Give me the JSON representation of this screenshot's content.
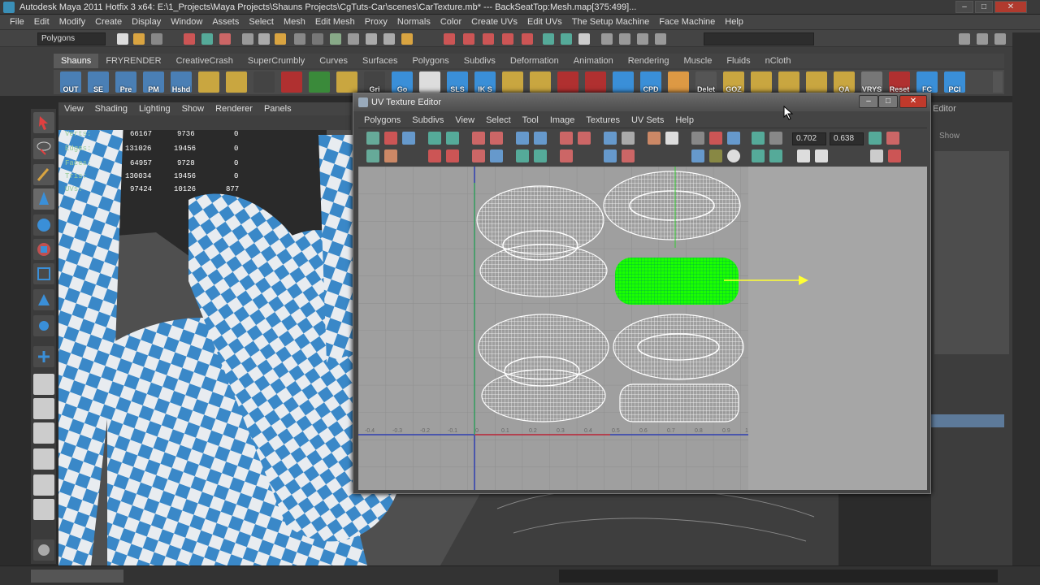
{
  "window": {
    "title": "Autodesk Maya 2011 Hotfix 3 x64: E:\\1_Projects\\Maya Projects\\Shauns Projects\\CgTuts-Car\\scenes\\CarTexture.mb*  ---  BackSeatTop:Mesh.map[375:499]..."
  },
  "menubar": [
    "File",
    "Edit",
    "Modify",
    "Create",
    "Display",
    "Window",
    "Assets",
    "Select",
    "Mesh",
    "Edit Mesh",
    "Proxy",
    "Normals",
    "Color",
    "Create UVs",
    "Edit UVs",
    "The Setup Machine",
    "Face Machine",
    "Help"
  ],
  "statusline": {
    "mode": "Polygons"
  },
  "shelf": {
    "tabs": [
      "Shauns",
      "FRYRENDER",
      "CreativeCrash",
      "SuperCrumbly",
      "Curves",
      "Surfaces",
      "Polygons",
      "Subdivs",
      "Deformation",
      "Animation",
      "Rendering",
      "Muscle",
      "Fluids",
      "nCloth"
    ],
    "active_tab": "Shauns",
    "buttons": [
      "OUT",
      "SE",
      "Pre",
      "PM",
      "Hshd",
      "",
      "",
      "",
      "",
      "",
      "",
      "Gri",
      "Go",
      "",
      "SLS",
      "IK S",
      "",
      "",
      "",
      "",
      "",
      "CPD",
      "",
      "Delet",
      "GOZ",
      "",
      "",
      "",
      "QA",
      "VRYS",
      "Reset",
      "FC",
      "PCI"
    ]
  },
  "viewport": {
    "menu": [
      "View",
      "Shading",
      "Lighting",
      "Show",
      "Renderer",
      "Panels"
    ],
    "hud": [
      {
        "label": "Verts:",
        "a": "66167",
        "b": "9736",
        "c": "0"
      },
      {
        "label": "Edges:",
        "a": "131026",
        "b": "19456",
        "c": "0"
      },
      {
        "label": "Faces:",
        "a": "64957",
        "b": "9728",
        "c": "0"
      },
      {
        "label": "Tris:",
        "a": "130034",
        "b": "19456",
        "c": "0"
      },
      {
        "label": "UVs:",
        "a": "97424",
        "b": "10126",
        "c": "877"
      }
    ]
  },
  "uv_editor": {
    "title": "UV Texture Editor",
    "menu": [
      "Polygons",
      "Subdivs",
      "View",
      "Select",
      "Tool",
      "Image",
      "Textures",
      "UV Sets",
      "Help"
    ],
    "field_u": "0.702",
    "field_v": "0.638",
    "axis_labels_x": [
      "-0.4",
      "-0.3",
      "-0.2",
      "-0.1",
      "0",
      "0.1",
      "0.2",
      "0.3",
      "0.4",
      "0.5",
      "0.6",
      "0.7",
      "0.8",
      "0.9",
      "1"
    ]
  },
  "right_panel": {
    "label1": "Editor",
    "label2": "Show"
  },
  "colors": {
    "selection_green": "#1aff00",
    "manipulator_yellow": "#ffff33",
    "checker_blue": "#3a88c8",
    "uv_bg": "#a6a6a6"
  }
}
